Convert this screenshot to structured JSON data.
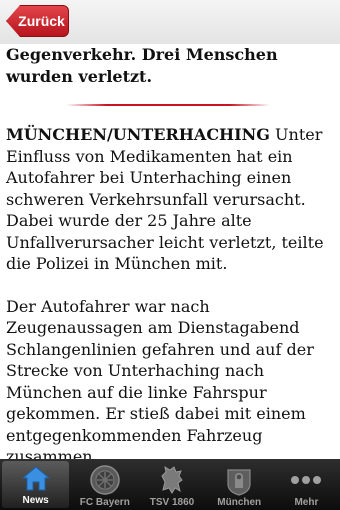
{
  "nav": {
    "back_label": "Zurück"
  },
  "article": {
    "prev_text": "Gegenverkehr. Drei Menschen wurden verletzt.",
    "dateline": "MÜNCHEN/UNTERHACHING",
    "para1_body": " Unter Einfluss von Medikamenten hat ein Autofahrer bei Unterhaching einen schweren Verkehrsunfall verursacht. Dabei wurde der 25 Jahre alte Unfallverursacher leicht verletzt, teilte die Polizei in München mit.",
    "para2": "Der Autofahrer war nach Zeugenaussagen am Dienstagabend Schlangenlinien gefahren und auf der Strecke von Unterhaching nach München auf die linke Fahrspur gekommen. Er stieß dabei mit einem entgegenkommenden Fahrzeug zusammen."
  },
  "tabs": [
    {
      "label": "News",
      "icon": "home-icon"
    },
    {
      "label": "FC Bayern",
      "icon": "fc-bayern-logo-icon"
    },
    {
      "label": "TSV 1860",
      "icon": "tsv-1860-lion-icon"
    },
    {
      "label": "München",
      "icon": "munich-monk-icon"
    },
    {
      "label": "Mehr",
      "icon": "more-dots-icon"
    }
  ],
  "colors": {
    "accent": "#c8141e",
    "tabbar": "#1a1a1a",
    "tab_active_icon": "#3b8fe0"
  }
}
